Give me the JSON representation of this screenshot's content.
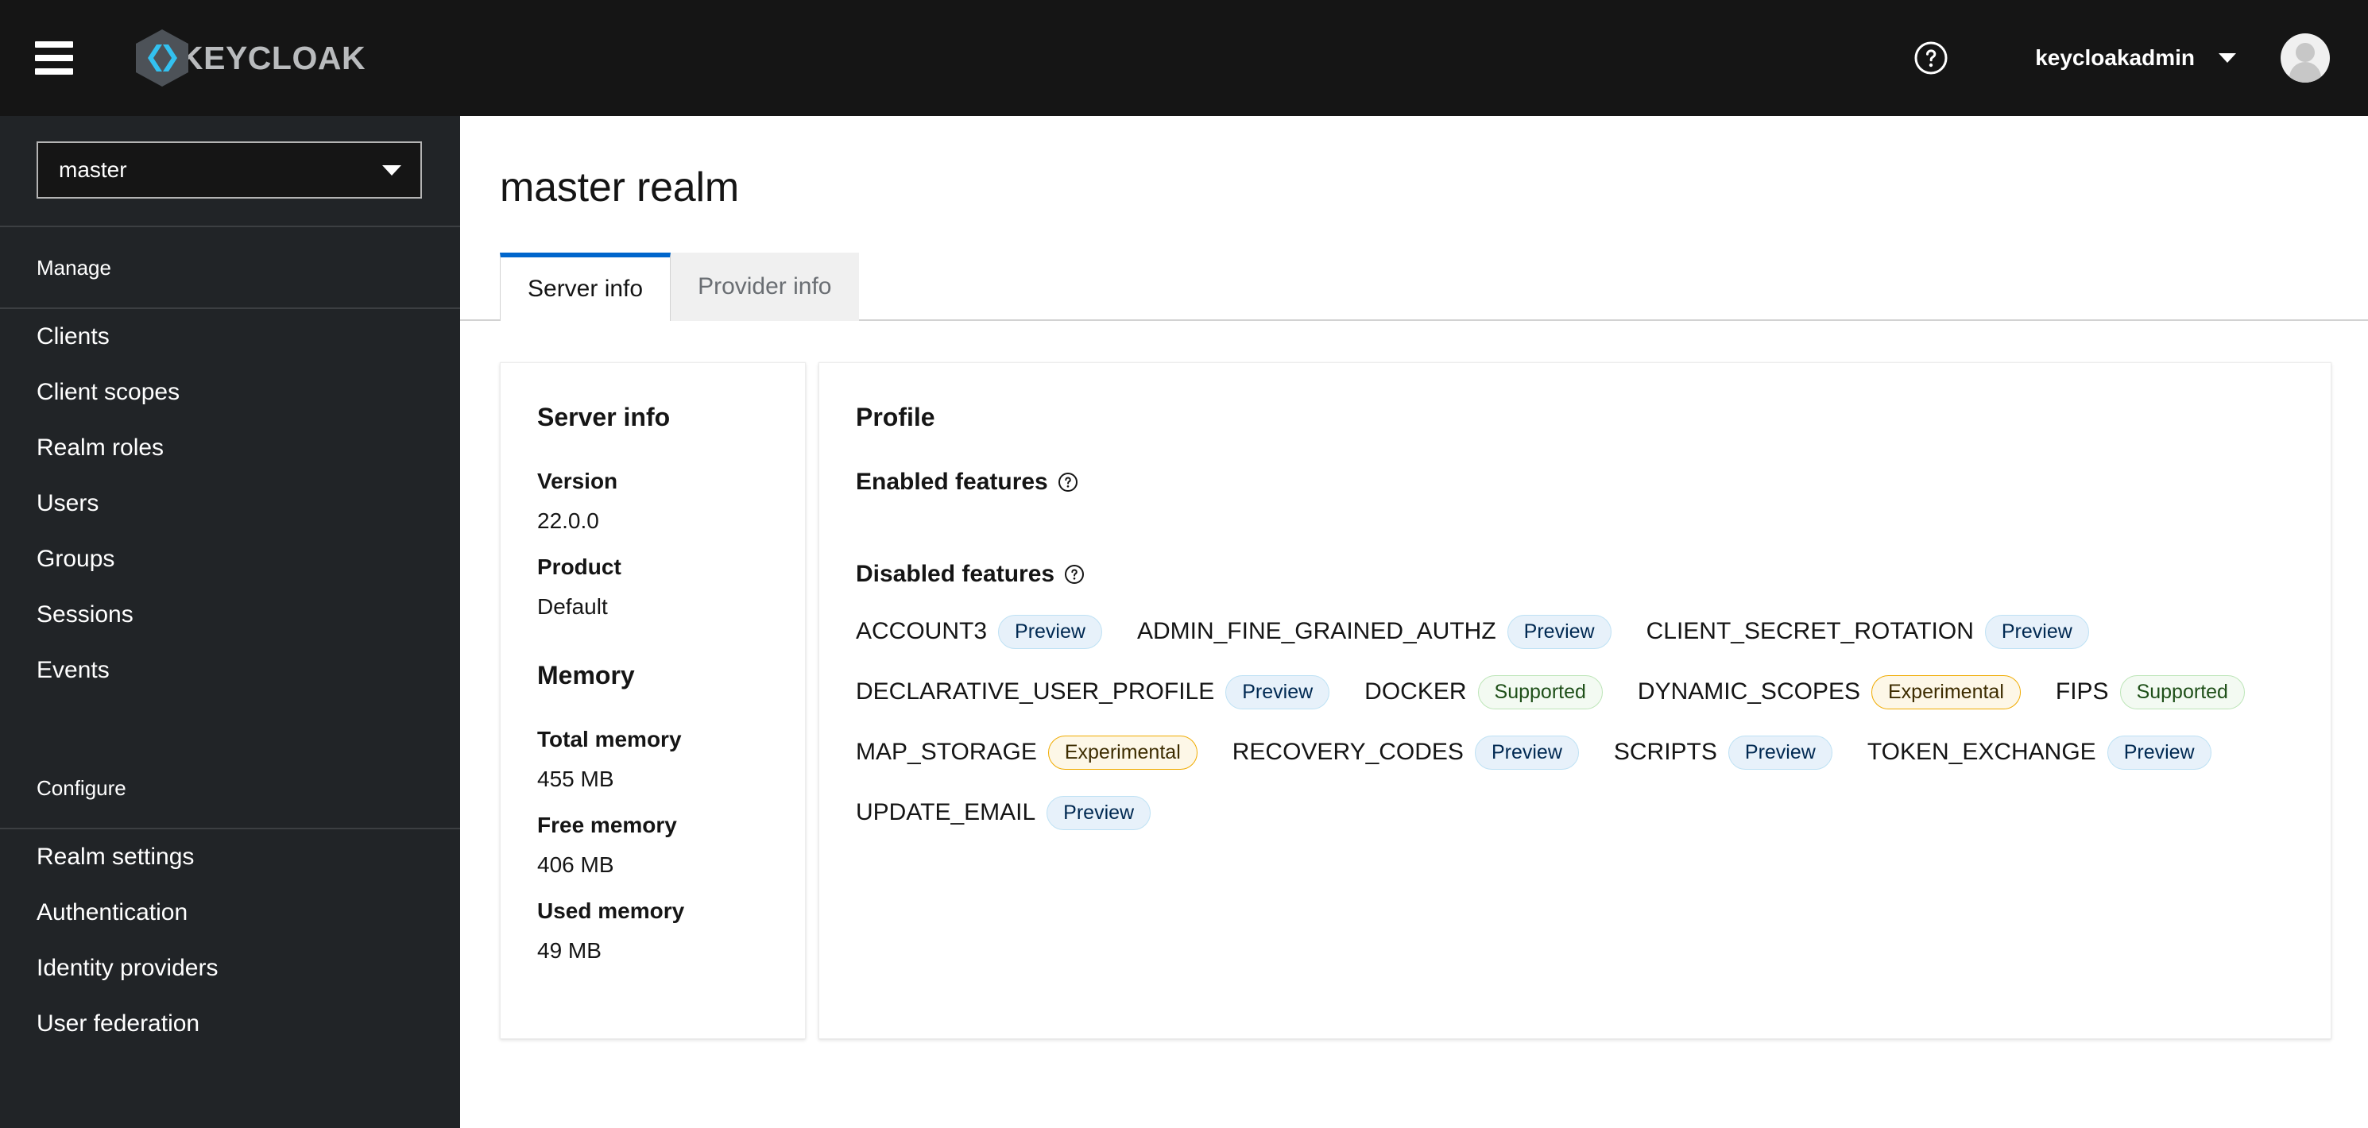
{
  "masthead": {
    "hamburger_label": "Global navigation",
    "brand_name": "KEYCLOAK",
    "help_icon": "help-circle-icon",
    "username": "keycloakadmin",
    "avatar_label": "User avatar"
  },
  "sidebar": {
    "realm_selector": {
      "value": "master",
      "caret_icon": "caret-down-icon"
    },
    "groups": [
      {
        "title": "Manage",
        "items": [
          {
            "label": "Clients"
          },
          {
            "label": "Client scopes"
          },
          {
            "label": "Realm roles"
          },
          {
            "label": "Users"
          },
          {
            "label": "Groups"
          },
          {
            "label": "Sessions"
          },
          {
            "label": "Events"
          }
        ]
      },
      {
        "title": "Configure",
        "items": [
          {
            "label": "Realm settings"
          },
          {
            "label": "Authentication"
          },
          {
            "label": "Identity providers"
          },
          {
            "label": "User federation"
          }
        ]
      }
    ]
  },
  "main": {
    "page_title": "master realm",
    "tabs": [
      {
        "label": "Server info",
        "active": true
      },
      {
        "label": "Provider info",
        "active": false
      }
    ],
    "server_info_card": {
      "heading": "Server info",
      "fields": [
        {
          "label": "Version",
          "value": "22.0.0"
        },
        {
          "label": "Product",
          "value": "Default"
        }
      ],
      "memory_heading": "Memory",
      "memory_fields": [
        {
          "label": "Total memory",
          "value": "455 MB"
        },
        {
          "label": "Free memory",
          "value": "406 MB"
        },
        {
          "label": "Used memory",
          "value": "49 MB"
        }
      ]
    },
    "profile_card": {
      "heading": "Profile",
      "enabled_features_label": "Enabled features",
      "enabled_features_help_icon": "help-circle-icon",
      "enabled_features": [],
      "disabled_features_label": "Disabled features",
      "disabled_features_help_icon": "help-circle-icon",
      "disabled_features": [
        {
          "name": "ACCOUNT3",
          "status": "Preview",
          "status_type": "preview"
        },
        {
          "name": "ADMIN_FINE_GRAINED_AUTHZ",
          "status": "Preview",
          "status_type": "preview"
        },
        {
          "name": "CLIENT_SECRET_ROTATION",
          "status": "Preview",
          "status_type": "preview"
        },
        {
          "name": "DECLARATIVE_USER_PROFILE",
          "status": "Preview",
          "status_type": "preview"
        },
        {
          "name": "DOCKER",
          "status": "Supported",
          "status_type": "supported"
        },
        {
          "name": "DYNAMIC_SCOPES",
          "status": "Experimental",
          "status_type": "experimental"
        },
        {
          "name": "FIPS",
          "status": "Supported",
          "status_type": "supported"
        },
        {
          "name": "MAP_STORAGE",
          "status": "Experimental",
          "status_type": "experimental"
        },
        {
          "name": "RECOVERY_CODES",
          "status": "Preview",
          "status_type": "preview"
        },
        {
          "name": "SCRIPTS",
          "status": "Preview",
          "status_type": "preview"
        },
        {
          "name": "TOKEN_EXCHANGE",
          "status": "Preview",
          "status_type": "preview"
        },
        {
          "name": "UPDATE_EMAIL",
          "status": "Preview",
          "status_type": "preview"
        }
      ]
    }
  },
  "colors": {
    "masthead_bg": "#151515",
    "sidebar_bg": "#212427",
    "accent_blue": "#0066cc",
    "brand_cyan": "#33c1f0",
    "preview_bg": "#e7f1fa",
    "supported_bg": "#f3faf2",
    "experimental_bg": "#fdf7e7"
  }
}
